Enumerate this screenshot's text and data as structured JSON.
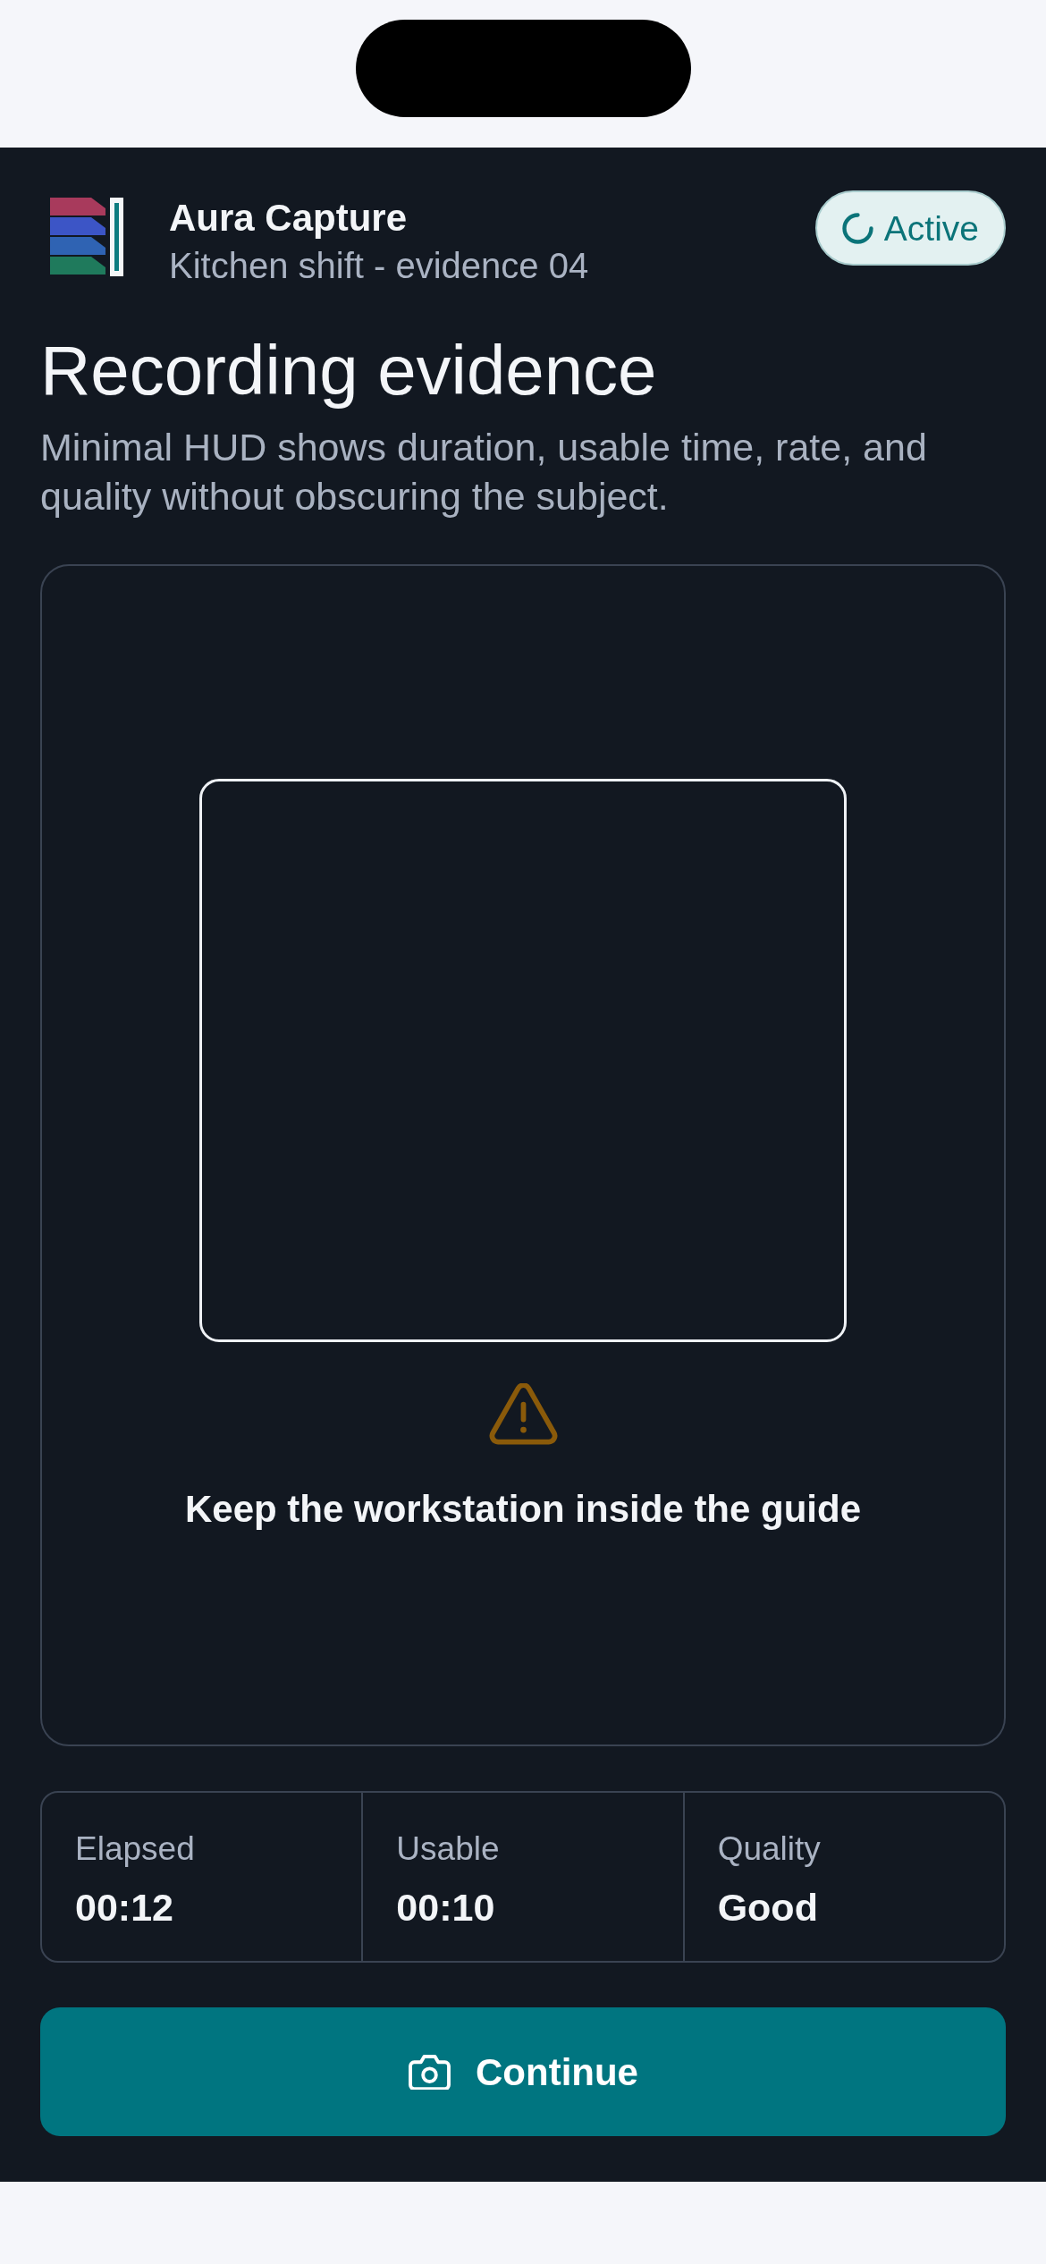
{
  "header": {
    "app_name": "Aura Capture",
    "subtitle": "Kitchen shift - evidence 04",
    "status_badge": "Active"
  },
  "title": "Recording evidence",
  "description": "Minimal HUD shows duration, usable time, rate, and quality without obscuring the subject.",
  "viewfinder": {
    "hint": "Keep the workstation inside the guide"
  },
  "stats": [
    {
      "label": "Elapsed",
      "value": "00:12"
    },
    {
      "label": "Usable",
      "value": "00:10"
    },
    {
      "label": "Quality",
      "value": "Good"
    }
  ],
  "primary_button": {
    "label": "Continue"
  }
}
